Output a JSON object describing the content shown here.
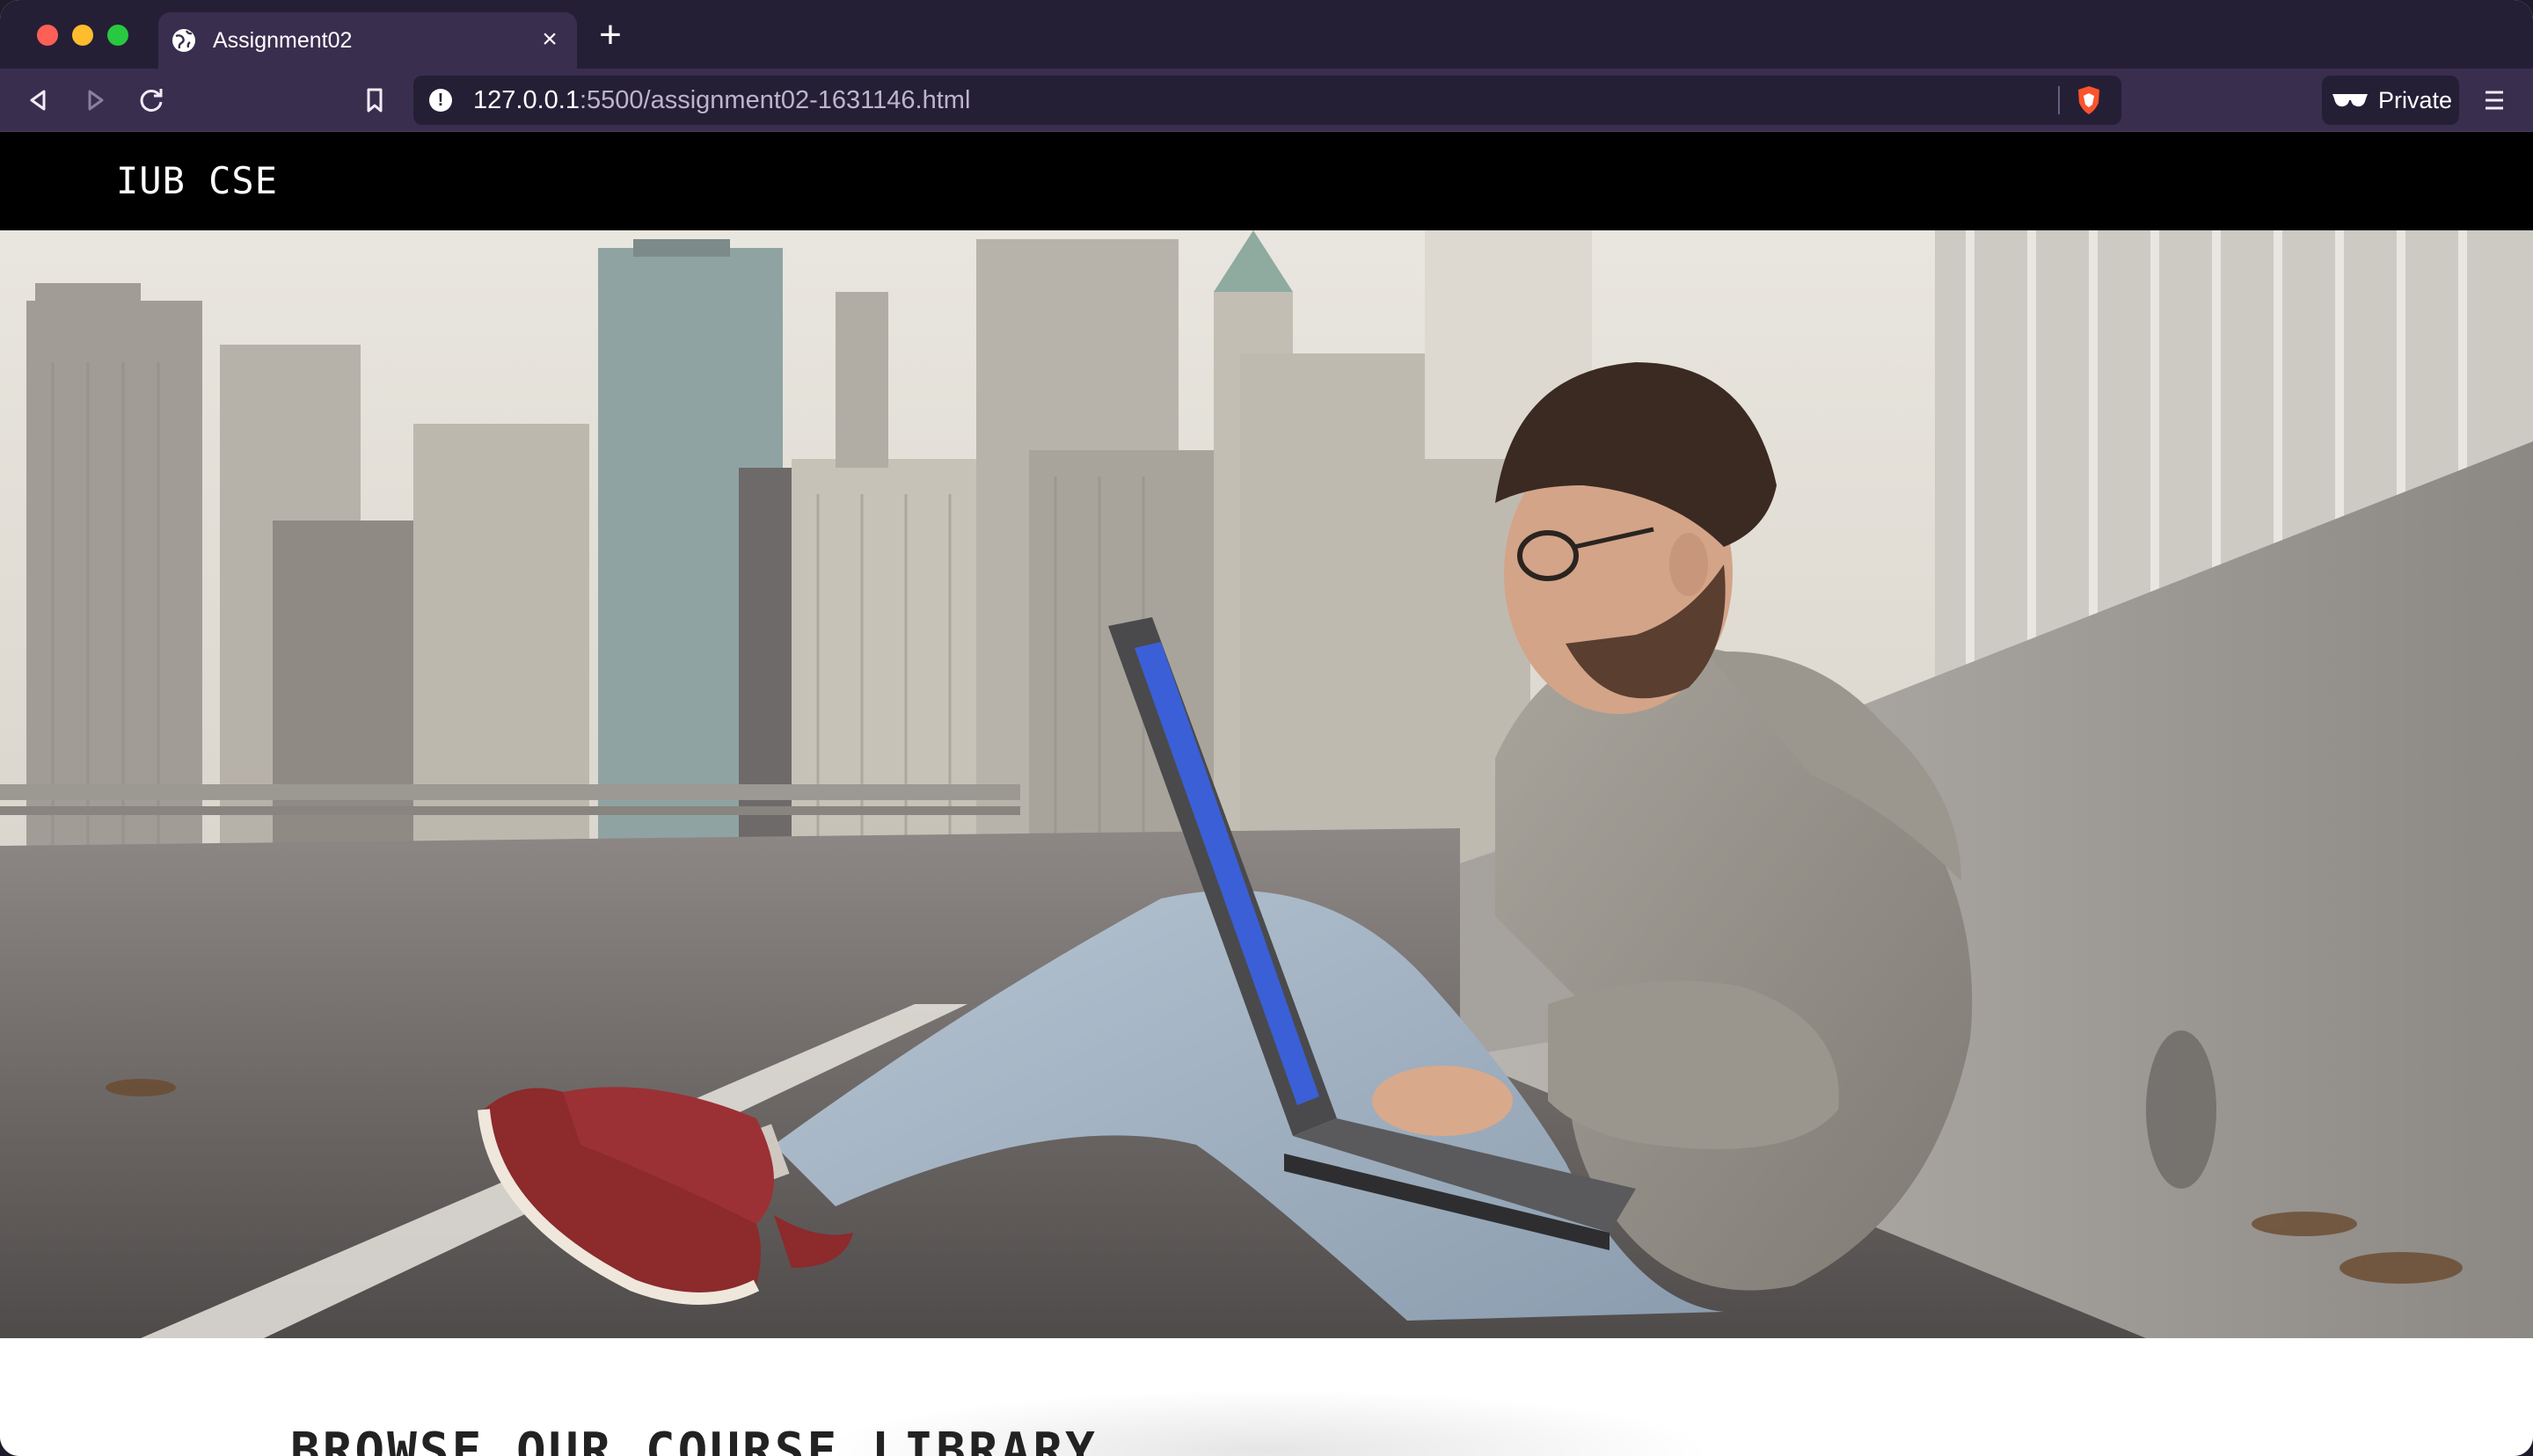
{
  "browser": {
    "tab": {
      "title": "Assignment02",
      "icon": "globe-icon",
      "close_icon": "close-icon"
    },
    "new_tab_icon": "plus-icon",
    "toolbar": {
      "back_icon": "back-icon",
      "forward_icon": "forward-icon",
      "reload_icon": "reload-icon",
      "bookmark_icon": "bookmark-icon",
      "menu_icon": "hamburger-icon"
    },
    "url": {
      "host": "127.0.0.1",
      "rest": ":5500/assignment02-1631146.html"
    },
    "private": {
      "label": "Private"
    },
    "colors": {
      "chrome_dark": "#251f36",
      "chrome_toolbar": "#3a2e4f"
    }
  },
  "site": {
    "brand": "IUB CSE",
    "hero_image": "person-with-laptop-city-image",
    "section_title": "BROWSE OUR COURSE LIBRARY"
  }
}
